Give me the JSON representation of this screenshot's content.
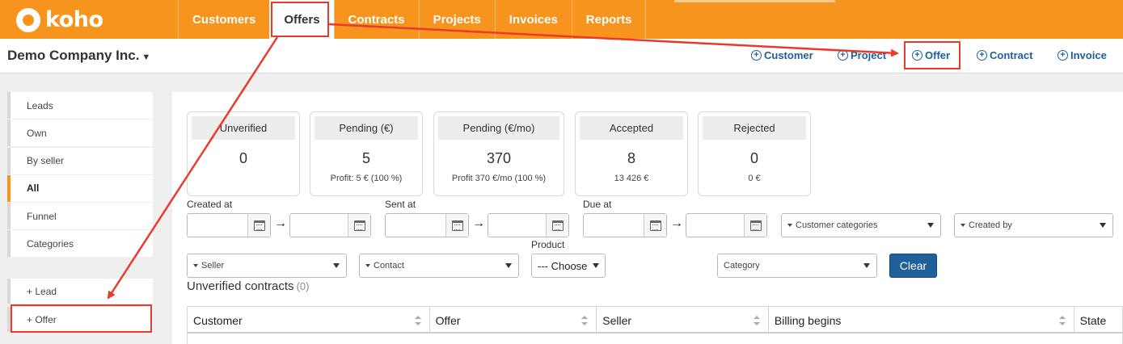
{
  "app": {
    "logo_text": "koho"
  },
  "nav": {
    "items": [
      {
        "label": "Customers"
      },
      {
        "label": "Offers",
        "active": true
      },
      {
        "label": "Contracts"
      },
      {
        "label": "Projects"
      },
      {
        "label": "Invoices"
      },
      {
        "label": "Reports"
      }
    ]
  },
  "company": {
    "name": "Demo Company Inc."
  },
  "quick_actions": {
    "customer": "Customer",
    "project": "Project",
    "offer": "Offer",
    "contract": "Contract",
    "invoice": "Invoice"
  },
  "sidebar": {
    "items": [
      {
        "label": "Leads"
      },
      {
        "label": "Own"
      },
      {
        "label": "By seller"
      },
      {
        "label": "All",
        "active": true
      },
      {
        "label": "Funnel"
      },
      {
        "label": "Categories"
      }
    ],
    "actions": [
      {
        "label": "+ Lead"
      },
      {
        "label": "+ Offer"
      }
    ]
  },
  "cards": [
    {
      "title": "Unverified",
      "value": "0",
      "sub": ""
    },
    {
      "title": "Pending (€)",
      "value": "5",
      "sub": "Profit: 5 € (100 %)"
    },
    {
      "title": "Pending (€/mo)",
      "value": "370",
      "sub": "Profit 370 €/mo (100 %)"
    },
    {
      "title": "Accepted",
      "value": "8",
      "sub": "13 426 €"
    },
    {
      "title": "Rejected",
      "value": "0",
      "sub": "0 €"
    }
  ],
  "filters": {
    "created_at": "Created at",
    "sent_at": "Sent at",
    "due_at": "Due at",
    "product": "Product",
    "customer_categories": "Customer categories",
    "created_by": "Created by",
    "seller": "Seller",
    "contact": "Contact",
    "product_choose": "--- Choose",
    "category": "Category",
    "clear": "Clear",
    "range_arrow": "→"
  },
  "section": {
    "title": "Unverified contracts",
    "count": "(0)"
  },
  "table": {
    "columns": [
      "Customer",
      "Offer",
      "Seller",
      "Billing begins",
      "State"
    ]
  },
  "colors": {
    "brand": "#f7941d",
    "primary": "#1f5f9a",
    "annotation": "#ea3a2d"
  }
}
